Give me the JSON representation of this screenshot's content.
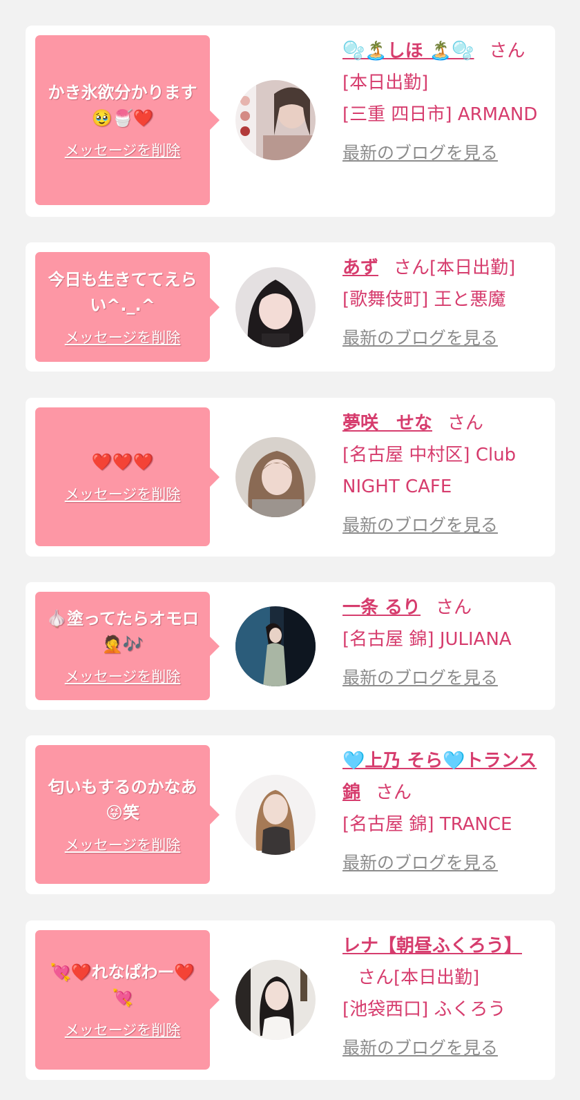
{
  "labels": {
    "delete": "メッセージを削除",
    "honorific": "さん",
    "blog": "最新のブログを見る"
  },
  "colors": {
    "bubble": "#fd97a5",
    "accent": "#d63c6d",
    "blog_link": "#8c8c8c",
    "background": "#f2f2f2"
  },
  "cards": [
    {
      "message": "かき氷欲分かります🥹🍧❤️",
      "name": "🫧🏝️しほ 🏝️🫧",
      "status": "[本日出勤]",
      "location": "[三重 四日市] ARMAND"
    },
    {
      "message": "今日も生きててえらい^._.^",
      "name": "あず",
      "status": "[本日出勤]",
      "location": "[歌舞伎町] 王と悪魔"
    },
    {
      "message": "❤️❤️❤️",
      "name": "夢咲　せな",
      "status": "",
      "location": "[名古屋 中村区] Club NIGHT CAFE"
    },
    {
      "message": "🧄塗ってたらオモロ🤦🎶",
      "name": "一条 るり",
      "status": "",
      "location": "[名古屋 錦] JULIANA"
    },
    {
      "message": "匂いもするのかなあ😝笑",
      "name": "🩵上乃 そら🩵トランス 錦",
      "status": "",
      "location": "[名古屋 錦] TRANCE"
    },
    {
      "message": "💘❤️れなぱわー❤️💘",
      "name": "レナ【朝昼ふくろう】",
      "status": "[本日出勤]",
      "location": "[池袋西口] ふくろう"
    }
  ]
}
